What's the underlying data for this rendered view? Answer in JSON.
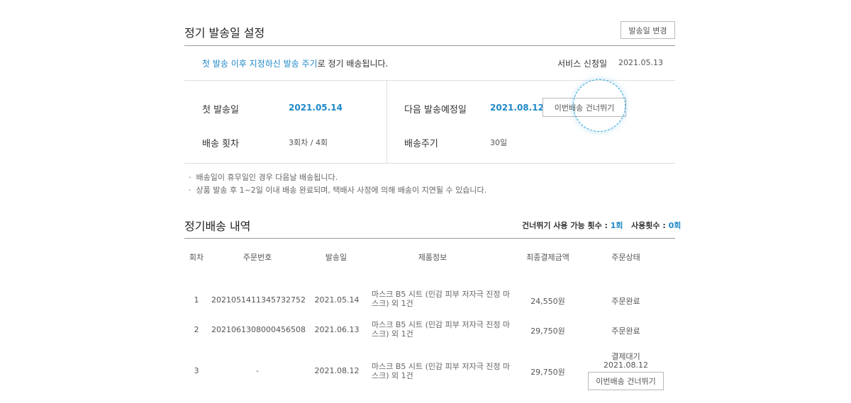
{
  "settings": {
    "title": "정기 발송일 설정",
    "change_button": "발송일 변경",
    "info_blue": "첫 발송 이후 지정하신 발송 주기",
    "info_rest": "로 정기 배송됩니다.",
    "service_label": "서비스 신청일",
    "service_date": "2021.05.13",
    "first_ship_label": "첫 발송일",
    "first_ship_value": "2021.05.14",
    "count_label": "배송 횟차",
    "count_value": "3회차 / 4회",
    "next_label": "다음 발송예정일",
    "next_value": "2021.08.12",
    "skip_button": "이번배송 건너뛰기",
    "cycle_label": "배송주기",
    "cycle_value": "30일",
    "notes": [
      "배송일이 휴무일인 경우 다음날 배송됩니다.",
      "상품 발송 후 1~2일 이내 배송 완료되며, 택배사 사정에 의해 배송이 지연될 수 있습니다."
    ]
  },
  "history": {
    "title": "정기배송 내역",
    "skip_avail_label": "건너뛰기 사용 가능 횟수 :",
    "skip_avail_value": "1회",
    "used_label": "사용횟수 :",
    "used_value": "0회",
    "columns": [
      "회차",
      "주문번호",
      "발송일",
      "제품정보",
      "최종결제금액",
      "주문상태"
    ],
    "rows": [
      {
        "no": "1",
        "order": "2021051411345732752",
        "date": "2021.05.14",
        "product_l1": "마스크 B5 시트 (민감 피부 저자극 진정 마",
        "product_l2": "스크) 외 1건",
        "amount": "24,550원",
        "status": "주문완료"
      },
      {
        "no": "2",
        "order": "2021061308000456508",
        "date": "2021.06.13",
        "product_l1": "마스크 B5 시트 (민감 피부 저자극 진정 마",
        "product_l2": "스크) 외 1건",
        "amount": "29,750원",
        "status": "주문완료"
      },
      {
        "no": "3",
        "order": "-",
        "date": "2021.08.12",
        "product_l1": "마스크 B5 시트 (민감 피부 저자극 진정 마",
        "product_l2": "스크) 외 1건",
        "amount": "29,750원",
        "status": "결제대기",
        "status_date": "2021.08.12",
        "skip_button": "이번배송 건너뛰기"
      }
    ]
  }
}
